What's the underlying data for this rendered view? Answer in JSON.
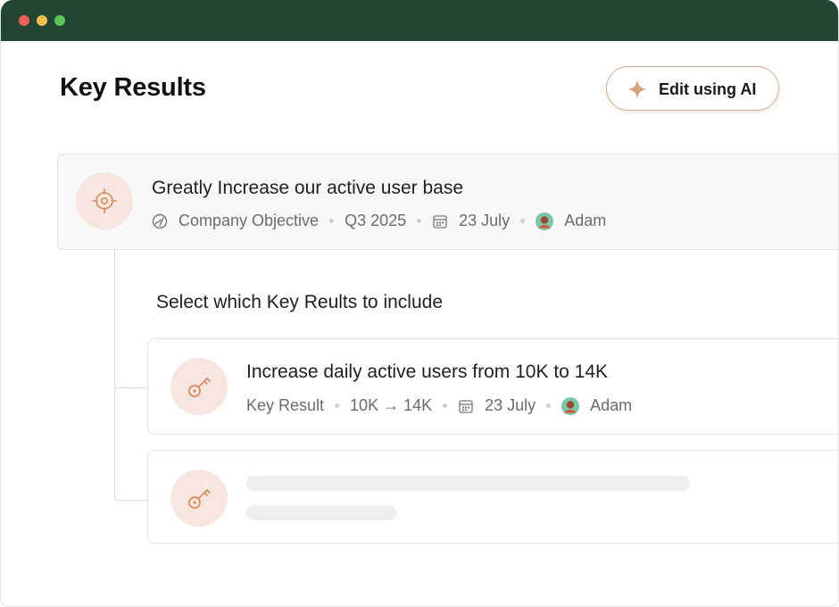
{
  "window": {
    "titlebar_color": "#234534",
    "traffic_lights": [
      "#ee5f57",
      "#eec04a",
      "#5fc454"
    ]
  },
  "header": {
    "title": "Key Results",
    "ai_button": {
      "label": "Edit using AI",
      "icon": "sparkle-icon",
      "accent": "#d9a98c"
    }
  },
  "objective": {
    "icon": "target-icon",
    "title": "Greatly Increase our active user base",
    "type_icon": "objective-type-icon",
    "type": "Company Objective",
    "period": "Q3 2025",
    "date_icon": "calendar-icon",
    "date": "23 July",
    "owner": "Adam"
  },
  "section_label": "Select which Key Reults to include",
  "key_results": [
    {
      "icon": "key-icon",
      "title": "Increase daily active users from 10K to 14K",
      "type": "Key Result",
      "range": "10K → 14K",
      "date": "23 July",
      "owner": "Adam"
    },
    {
      "icon": "key-icon",
      "loading": true
    }
  ],
  "colors": {
    "icon_accent": "#d98a5f",
    "icon_bg": "#f6e6df",
    "meta_text": "#6b6b6b"
  }
}
